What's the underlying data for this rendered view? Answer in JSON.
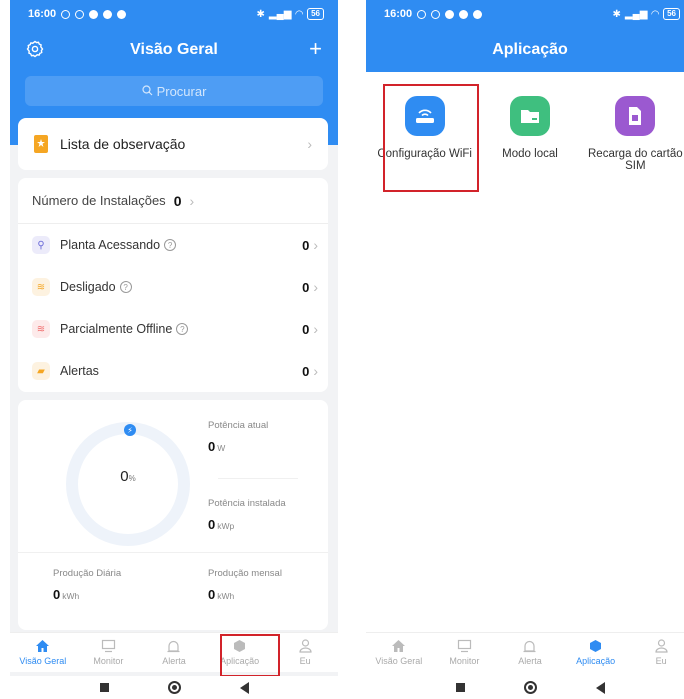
{
  "status": {
    "time": "16:00",
    "battery": "56"
  },
  "left": {
    "title": "Visão Geral",
    "add_symbol": "+",
    "search_placeholder": "Procurar",
    "watchlist_label": "Lista de observação",
    "installations_label": "Número de Instalações",
    "installations_count": "0",
    "status_rows": [
      {
        "label": "Planta Acessando",
        "value": "0",
        "icon": "plug-icon",
        "color": "#6a6ad8"
      },
      {
        "label": "Desligado",
        "value": "0",
        "icon": "wifi-off-icon",
        "color": "#f5a623"
      },
      {
        "label": "Parcialmente Offline",
        "value": "0",
        "icon": "wifi-partial-icon",
        "color": "#f06a6a"
      },
      {
        "label": "Alertas",
        "value": "0",
        "icon": "alert-icon",
        "color": "#f5a623"
      }
    ],
    "gauge_value": "0",
    "gauge_unit": "%",
    "current_power_label": "Potência atual",
    "current_power_value": "0",
    "current_power_unit": "W",
    "installed_power_label": "Potência instalada",
    "installed_power_value": "0",
    "installed_power_unit": "kWp",
    "daily_label": "Produção Diária",
    "daily_value": "0",
    "daily_unit": "kWh",
    "monthly_label": "Produção mensal",
    "monthly_value": "0",
    "monthly_unit": "kWh"
  },
  "tabs": [
    {
      "label": "Visão Geral",
      "icon": "home-icon"
    },
    {
      "label": "Monitor",
      "icon": "monitor-icon"
    },
    {
      "label": "Alerta",
      "icon": "alarm-icon"
    },
    {
      "label": "Aplicação",
      "icon": "app-cube-icon"
    },
    {
      "label": "Eu",
      "icon": "user-icon"
    }
  ],
  "right": {
    "title": "Aplicação",
    "apps": [
      {
        "label": "Configuração WiFi",
        "icon": "router-wifi-icon",
        "color": "#2f8cf2"
      },
      {
        "label": "Modo local",
        "icon": "folder-icon",
        "color": "#3fbf7f"
      },
      {
        "label": "Recarga do cartão SIM",
        "icon": "sim-card-icon",
        "color": "#9b59d0"
      }
    ]
  },
  "colors": {
    "primary": "#2f8cf2",
    "highlight": "#d2232a"
  }
}
